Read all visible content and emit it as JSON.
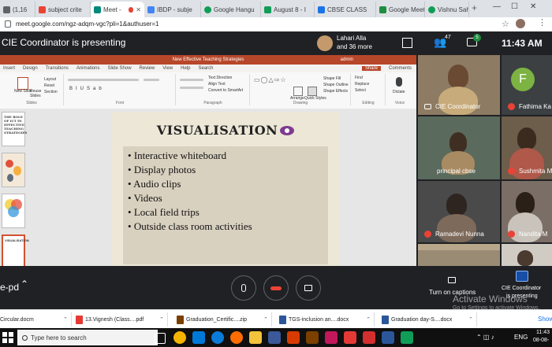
{
  "browser": {
    "tabs": [
      {
        "label": "(1,16",
        "color": "#5f6368"
      },
      {
        "label": "subject crite",
        "color": "#ea4335"
      },
      {
        "label": "Meet -",
        "color": "#00897b"
      },
      {
        "label": "IBDP - subje",
        "color": "#4285f4"
      },
      {
        "label": "Google Hangu",
        "color": "#0f9d58"
      },
      {
        "label": "August 8 - I",
        "color": "#0f9d58"
      },
      {
        "label": "CBSE CLASS",
        "color": "#1a73e8"
      },
      {
        "label": "Google Meet",
        "color": "#1e8e3e"
      },
      {
        "label": "Vishnu Sahu",
        "color": "#0f9d58"
      }
    ],
    "new_tab": "+",
    "url": "meet.google.com/ngz-adqm-vgc?pli=1&authuser=1"
  },
  "meet": {
    "presenting_banner": "CIE Coordinator is presenting",
    "presenter_name": "Lahari Alla",
    "presenter_more": "and 36 more",
    "people_count": "47",
    "chat_count": "5",
    "clock": "11:43 AM",
    "meeting_code": "e-pd",
    "turn_on_captions": "Turn on captions",
    "presenting_label_1": "CIE Coordinator",
    "presenting_label_2": "is presenting",
    "participants": [
      {
        "name": "CIE Coordinator",
        "muted": false
      },
      {
        "name": "Fathima Ka",
        "initial": "F",
        "muted": true
      },
      {
        "name": "principal cbse",
        "muted": false
      },
      {
        "name": "Sushmita M",
        "muted": true
      },
      {
        "name": "Ramadevi Nunna",
        "muted": true
      },
      {
        "name": "Nandita M",
        "muted": true
      },
      {
        "name": "",
        "muted": false
      },
      {
        "name": "",
        "muted": false
      }
    ]
  },
  "ppt": {
    "window_title": "New Effective Teaching Strategies",
    "user": "admin",
    "menu": [
      "Insert",
      "Design",
      "Transitions",
      "Animations",
      "Slide Show",
      "Review",
      "View",
      "Help",
      "Search"
    ],
    "share": "Share",
    "comments": "Comments",
    "ribbon_groups": [
      "Slides",
      "Font",
      "Paragraph",
      "Drawing",
      "Editing",
      "Voice"
    ],
    "ribbon_buttons": {
      "new_slide": "New Slide",
      "reuse_slides": "Reuse Slides",
      "layout": "Layout",
      "reset": "Reset",
      "section": "Section",
      "find": "Find",
      "replace": "Replace",
      "select": "Select",
      "dictate": "Dictate",
      "text_direction": "Text Direction",
      "align_text": "Align Text",
      "convert_smartart": "Convert to SmartArt",
      "arrange": "Arrange",
      "quick_styles": "Quick Styles",
      "shape_fill": "Shape Fill",
      "shape_outline": "Shape Outline",
      "shape_effects": "Shape Effects"
    },
    "thumbnail_text": "THE ROLE OF ICT IN EFFECTIVE TEACHING STRATEGIES",
    "thumbnail_title_small": "VISUALISATION",
    "slide_title": "VISUALISATION",
    "bullets": [
      "Interactive whiteboard",
      "Display photos",
      "Audio clips",
      "Videos",
      "Local field trips",
      "Outside class room activities"
    ]
  },
  "windows_watermark": {
    "line1": "Activate Windows",
    "line2": "Go to Settings to activate Windows."
  },
  "downloads": [
    {
      "label": "Circular.docm",
      "color": "#2b579a"
    },
    {
      "label": "13.Vignesh (Class....pdf",
      "color": "#e53935"
    },
    {
      "label": "Graduation_Certific....zip",
      "color": "#7b3f00"
    },
    {
      "label": "TGS-inclusion an....docx",
      "color": "#2b579a"
    },
    {
      "label": "Graduation day-S....docx",
      "color": "#2b579a"
    }
  ],
  "show_all": "Show",
  "taskbar": {
    "search_placeholder": "Type here to search",
    "language": "ENG",
    "time": "11:43",
    "date": "08-08-"
  }
}
